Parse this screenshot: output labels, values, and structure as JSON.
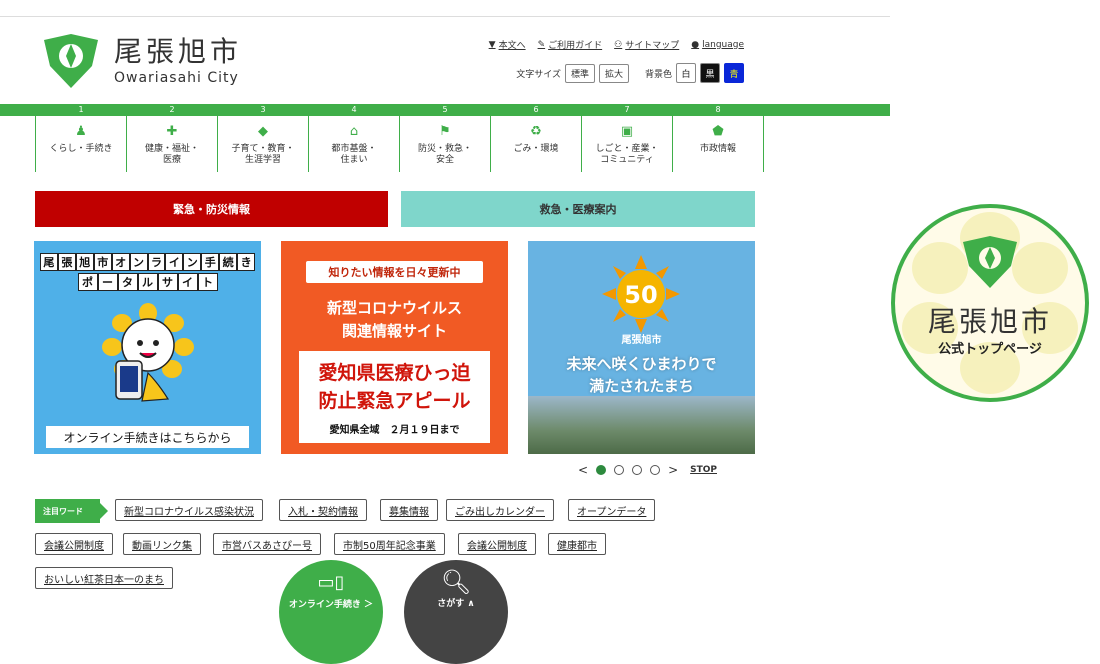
{
  "logo": {
    "jp": "尾張旭市",
    "en": "Owariasahi City"
  },
  "util": [
    {
      "icon": "▼",
      "label": "本文へ"
    },
    {
      "icon": "✎",
      "label": "ご利用ガイド"
    },
    {
      "icon": "⚇",
      "label": "サイトマップ"
    },
    {
      "icon": "●",
      "label": "language"
    }
  ],
  "tools": {
    "font_label": "文字サイズ",
    "font_std": "標準",
    "font_big": "拡大",
    "bg_label": "背景色",
    "bg_white": "白",
    "bg_black": "黒",
    "bg_blue": "青"
  },
  "gnav": [
    {
      "num": "1",
      "icon": "♟",
      "label": "くらし・手続き"
    },
    {
      "num": "2",
      "icon": "✚",
      "label": "健康・福祉・\n医療"
    },
    {
      "num": "3",
      "icon": "◆",
      "label": "子育て・教育・\n生涯学習"
    },
    {
      "num": "4",
      "icon": "⌂",
      "label": "都市基盤・\n住まい"
    },
    {
      "num": "5",
      "icon": "⚑",
      "label": "防災・救急・\n安全"
    },
    {
      "num": "6",
      "icon": "♻",
      "label": "ごみ・環境"
    },
    {
      "num": "7",
      "icon": "▣",
      "label": "しごと・産業・\nコミュニティ"
    },
    {
      "num": "8",
      "icon": "⬟",
      "label": "市政情報"
    }
  ],
  "emergency": "緊急・防災情報",
  "medical": "救急・医療案内",
  "banner1": {
    "row1": [
      "尾",
      "張",
      "旭",
      "市",
      "オ",
      "ン",
      "ラ",
      "イ",
      "ン",
      "手",
      "続",
      "き"
    ],
    "row2": [
      "ポ",
      "ー",
      "タ",
      "ル",
      "サ",
      "イ",
      "ト"
    ],
    "cta": "オンライン手続きはこちらから"
  },
  "banner2": {
    "header": "知りたい情報を日々更新中",
    "title1": "新型コロナウイルス",
    "title2": "関連情報サイト",
    "big1": "愛知県医療ひっ迫",
    "big2": "防止緊急アピール",
    "small": "愛知県全域　２月１９日まで"
  },
  "banner3": {
    "badge": "50",
    "city": "尾張旭市",
    "tag1": "未来へ咲くひまわりで",
    "tag2": "満たされたまち"
  },
  "slider": {
    "prev": "<",
    "next": ">",
    "stop": "STOP",
    "active_index": 0,
    "count": 4
  },
  "hot_label": "注目ワード",
  "keywords": [
    "新型コロナウイルス感染状況",
    "入札・契約情報",
    "募集情報",
    "ごみ出しカレンダー",
    "オープンデータ",
    "会議公開制度",
    "動画リンク集",
    "市営バスあさぴー号",
    "市制50周年記念事業",
    "会議公開制度",
    "健康都市",
    "おいしい紅茶日本一のまち"
  ],
  "fab": {
    "online": "オンライン手続き ＞",
    "search": "さがす ∧"
  },
  "seal": {
    "jp": "尾張旭市",
    "sub": "公式トップページ"
  },
  "colors": {
    "green": "#3fae49",
    "red": "#c00000",
    "teal": "#7fd6cb",
    "orange": "#f15a24",
    "sky": "#4fb0e8"
  }
}
